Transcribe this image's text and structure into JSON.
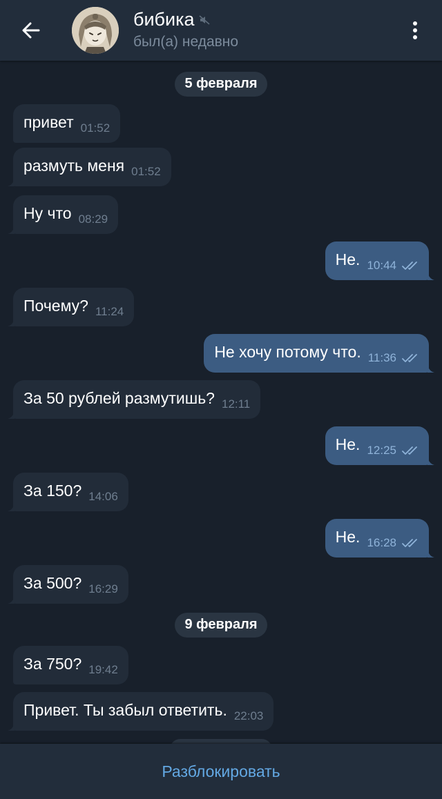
{
  "header": {
    "title": "бибика",
    "status": "был(а) недавно",
    "back_icon": "arrow-left-icon",
    "mute_icon": "speaker-muted-icon",
    "menu_icon": "more-vertical-icon"
  },
  "dates": {
    "first": "5 февраля",
    "second": "9 февраля"
  },
  "messages": [
    {
      "dir": "in",
      "text": "привет",
      "time": "01:52"
    },
    {
      "dir": "in",
      "text": "размуть меня",
      "time": "01:52"
    },
    {
      "dir": "in",
      "text": "Ну что",
      "time": "08:29"
    },
    {
      "dir": "out",
      "text": "Не.",
      "time": "10:44",
      "read": true
    },
    {
      "dir": "in",
      "text": "Почему?",
      "time": "11:24"
    },
    {
      "dir": "out",
      "text": "Не хочу потому что.",
      "time": "11:36",
      "read": true
    },
    {
      "dir": "in",
      "text": "За 50 рублей размутишь?",
      "time": "12:11"
    },
    {
      "dir": "out",
      "text": "Не.",
      "time": "12:25",
      "read": true
    },
    {
      "dir": "in",
      "text": "За 150?",
      "time": "14:06"
    },
    {
      "dir": "out",
      "text": "Не.",
      "time": "16:28",
      "read": true
    },
    {
      "dir": "in",
      "text": "За 500?",
      "time": "16:29"
    },
    {
      "dir": "in",
      "text": "За 750?",
      "time": "19:42"
    },
    {
      "dir": "in",
      "text": "Привет. Ты забыл ответить.",
      "time": "22:03"
    }
  ],
  "footer": {
    "unblock_label": "Разблокировать"
  },
  "colors": {
    "background": "#18202b",
    "header": "#222d3b",
    "incoming_bubble": "#222c39",
    "outgoing_bubble": "#3c5c82",
    "accent": "#63a8e3",
    "read_check": "#8fb3d9"
  }
}
